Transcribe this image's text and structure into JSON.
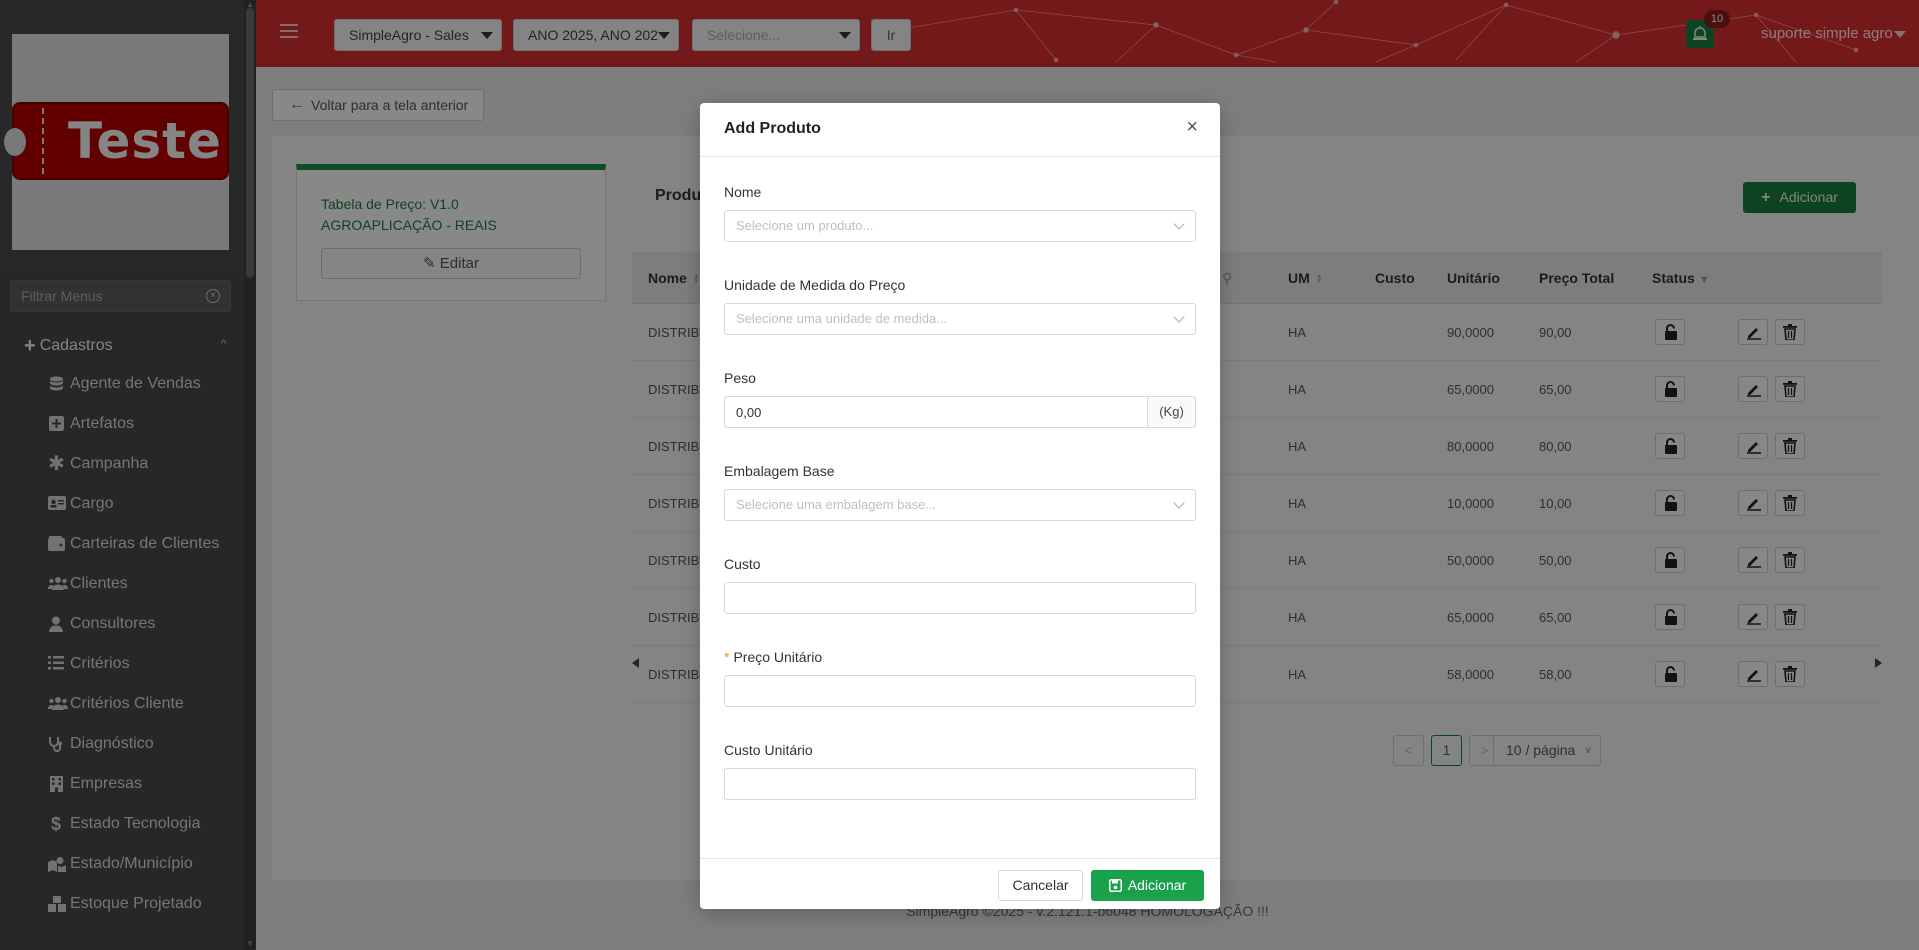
{
  "sidebar": {
    "logo_text": "Teste",
    "filter_placeholder": "Filtrar Menus",
    "group_label": "Cadastros",
    "items": [
      {
        "label": "Agente de Vendas",
        "icon": "database-icon"
      },
      {
        "label": "Artefatos",
        "icon": "plus-square-icon"
      },
      {
        "label": "Campanha",
        "icon": "asterisk-icon"
      },
      {
        "label": "Cargo",
        "icon": "id-card-icon"
      },
      {
        "label": "Carteiras de Clientes",
        "icon": "wallet-icon"
      },
      {
        "label": "Clientes",
        "icon": "users-icon"
      },
      {
        "label": "Consultores",
        "icon": "user-icon"
      },
      {
        "label": "Critérios",
        "icon": "list-icon"
      },
      {
        "label": "Critérios Cliente",
        "icon": "users-icon"
      },
      {
        "label": "Diagnóstico",
        "icon": "stethoscope-icon"
      },
      {
        "label": "Empresas",
        "icon": "building-icon"
      },
      {
        "label": "Estado Tecnologia",
        "icon": "dollar-icon"
      },
      {
        "label": "Estado/Município",
        "icon": "map-icon"
      },
      {
        "label": "Estoque Projetado",
        "icon": "boxes-icon"
      }
    ]
  },
  "header": {
    "company_select": "SimpleAgro - Sales",
    "year_select": "ANO 2025, ANO 202",
    "generic_select_placeholder": "Selecione...",
    "go_button": "Ir",
    "notification_count": "10",
    "user_name": "suporte simple agro",
    "brand_color": "#d32f2f"
  },
  "main": {
    "back_button": "Voltar para a tela anterior",
    "price_table_title": "Tabela de Preço: V1.0 AGROAPLICAÇÃO - REAIS",
    "edit_button": "Editar",
    "products_heading": "Produ",
    "add_button": "Adicionar",
    "columns": {
      "nome": "Nome",
      "um": "UM",
      "custo": "Custo",
      "unitario": "Unitário",
      "preco_total": "Preço Total",
      "status": "Status"
    },
    "rows": [
      {
        "nome": "DISTRIBU",
        "um": "HA",
        "unitario": "90,0000",
        "total": "90,00"
      },
      {
        "nome": "DISTRIBU",
        "um": "HA",
        "unitario": "65,0000",
        "total": "65,00"
      },
      {
        "nome": "DISTRIBU",
        "um": "HA",
        "unitario": "80,0000",
        "total": "80,00"
      },
      {
        "nome": "DISTRIBU",
        "um": "HA",
        "unitario": "10,0000",
        "total": "10,00"
      },
      {
        "nome": "DISTRIBU",
        "um": "HA",
        "unitario": "50,0000",
        "total": "50,00"
      },
      {
        "nome": "DISTRIBU",
        "um": "HA",
        "unitario": "65,0000",
        "total": "65,00"
      },
      {
        "nome": "DISTRIBU",
        "um": "HA",
        "unitario": "58,0000",
        "total": "58,00"
      }
    ],
    "pagination": {
      "prev": "<",
      "current_page": "1",
      "next": ">",
      "page_size": "10 / página"
    }
  },
  "footer": {
    "text": "SimpleAgro ©2025 - v.2.121.1-b6048 HOMOLOGAÇÃO !!!"
  },
  "modal": {
    "title": "Add Produto",
    "close": "×",
    "nome_label": "Nome",
    "nome_placeholder": "Selecione um produto...",
    "unidade_label": "Unidade de Medida do Preço",
    "unidade_placeholder": "Selecione uma unidade de medida...",
    "peso_label": "Peso",
    "peso_value": "0,00",
    "peso_unit": "(Kg)",
    "embalagem_label": "Embalagem Base",
    "embalagem_placeholder": "Selecione uma embalagem base...",
    "custo_label": "Custo",
    "custo_value": "",
    "preco_unitario_label": "Preço Unitário",
    "preco_unitario_value": "",
    "custo_unitario_label": "Custo Unitário",
    "custo_unitario_value": "",
    "cancel_button": "Cancelar",
    "submit_button": "Adicionar",
    "accent_color": "#19a14c"
  }
}
